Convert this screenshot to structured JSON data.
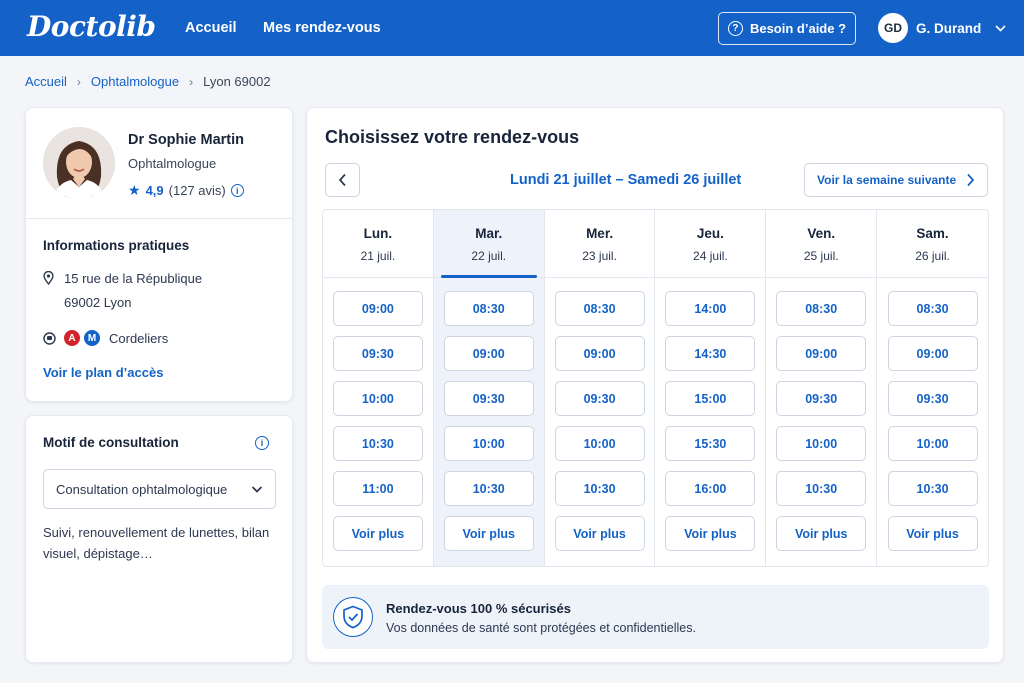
{
  "header": {
    "logo": "Doctolib",
    "nav": [
      "Accueil",
      "Mes rendez-vous"
    ],
    "help_label": "Besoin d’aide ?",
    "user_initials": "GD",
    "user_name": "G. Durand"
  },
  "breadcrumb": [
    "Accueil",
    "Ophtalmologue",
    "Lyon 69002"
  ],
  "doctor": {
    "name": "Dr Sophie Martin",
    "specialty": "Ophtalmologue",
    "rating": "4,9",
    "reviews": "(127 avis)",
    "info_title": "Informations pratiques",
    "address_line1": "15 rue de la République",
    "address_line2": "69002 Lyon",
    "metro_lines": [
      "A",
      "M"
    ],
    "metro_station": "Cordeliers",
    "plan_link": "Voir le plan d’accès"
  },
  "motif": {
    "title": "Motif de consultation",
    "selected": "Consultation ophtalmologique",
    "description": "Suivi, renouvellement de lunettes, bilan visuel, dépistage…"
  },
  "booking": {
    "title": "Choisissez votre rendez-vous",
    "week_label": "Lundi 21 juillet – Samedi 26 juillet",
    "next_week": "Voir la semaine suivante",
    "more_label": "Voir plus",
    "days": [
      {
        "name": "Lun.",
        "date": "21 juil.",
        "selected": false,
        "slots": [
          "09:00",
          "09:30",
          "10:00",
          "10:30",
          "11:00"
        ]
      },
      {
        "name": "Mar.",
        "date": "22 juil.",
        "selected": true,
        "slots": [
          "08:30",
          "09:00",
          "09:30",
          "10:00",
          "10:30"
        ]
      },
      {
        "name": "Mer.",
        "date": "23 juil.",
        "selected": false,
        "slots": [
          "08:30",
          "09:00",
          "09:30",
          "10:00",
          "10:30"
        ]
      },
      {
        "name": "Jeu.",
        "date": "24 juil.",
        "selected": false,
        "slots": [
          "14:00",
          "14:30",
          "15:00",
          "15:30",
          "16:00"
        ]
      },
      {
        "name": "Ven.",
        "date": "25 juil.",
        "selected": false,
        "slots": [
          "08:30",
          "09:00",
          "09:30",
          "10:00",
          "10:30"
        ]
      },
      {
        "name": "Sam.",
        "date": "26 juil.",
        "selected": false,
        "slots": [
          "08:30",
          "09:00",
          "09:30",
          "10:00",
          "10:30"
        ]
      }
    ],
    "secure_title": "Rendez-vous 100 % sécurisés",
    "secure_text": "Vos données de santé sont protégées et confidentielles."
  },
  "colors": {
    "brand": "#1462c8",
    "metro_a": "#d2232a",
    "metro_m": "#1462c8"
  }
}
